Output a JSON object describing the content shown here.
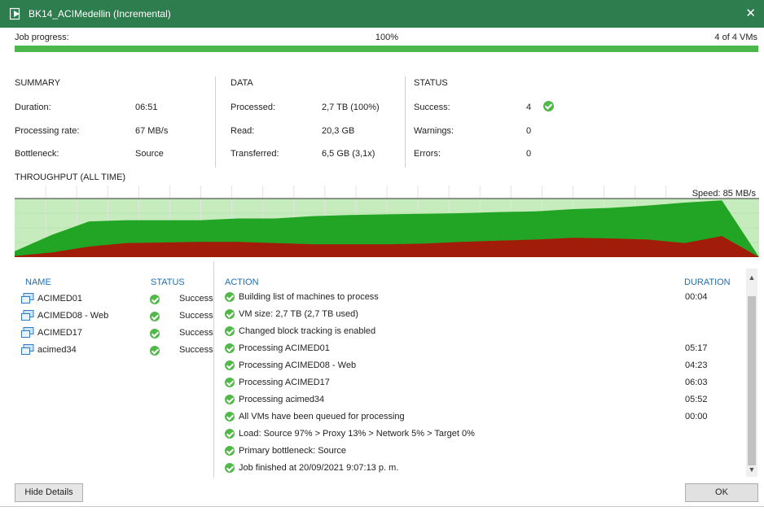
{
  "window": {
    "title": "BK14_ACIMedellin (Incremental)",
    "close": "✕"
  },
  "progress": {
    "label": "Job progress:",
    "percent_text": "100%",
    "vms_text": "4 of 4 VMs",
    "fraction": 1.0
  },
  "summary": {
    "heading": "SUMMARY",
    "rows": [
      {
        "label": "Duration:",
        "value": "06:51"
      },
      {
        "label": "Processing rate:",
        "value": "67 MB/s"
      },
      {
        "label": "Bottleneck:",
        "value": "Source"
      }
    ]
  },
  "data": {
    "heading": "DATA",
    "rows": [
      {
        "label": "Processed:",
        "value": "2,7 TB (100%)"
      },
      {
        "label": "Read:",
        "value": "20,3 GB"
      },
      {
        "label": "Transferred:",
        "value": "6,5 GB (3,1x)"
      }
    ]
  },
  "status": {
    "heading": "STATUS",
    "rows": [
      {
        "label": "Success:",
        "value": "4"
      },
      {
        "label": "Warnings:",
        "value": "0"
      },
      {
        "label": "Errors:",
        "value": "0"
      }
    ]
  },
  "throughput": {
    "title": "THROUGHPUT (ALL TIME)",
    "speed_label": "Speed: 85 MB/s",
    "colors": {
      "read": "#22a524",
      "transfer": "#a11c09",
      "bg": "#c6ecbe"
    },
    "read_series": [
      0.1,
      0.38,
      0.61,
      0.63,
      0.63,
      0.63,
      0.66,
      0.66,
      0.7,
      0.72,
      0.73,
      0.74,
      0.75,
      0.77,
      0.78,
      0.82,
      0.84,
      0.88,
      0.93,
      0.97,
      0.0
    ],
    "transfer_series": [
      0.02,
      0.08,
      0.18,
      0.24,
      0.25,
      0.26,
      0.26,
      0.24,
      0.22,
      0.22,
      0.22,
      0.23,
      0.26,
      0.28,
      0.3,
      0.33,
      0.32,
      0.3,
      0.24,
      0.36,
      0.0
    ]
  },
  "vms": {
    "col_name": "NAME",
    "col_status": "STATUS",
    "items": [
      {
        "name": "ACIMED01",
        "status": "Success"
      },
      {
        "name": "ACIMED08 - Web",
        "status": "Success"
      },
      {
        "name": "ACIMED17",
        "status": "Success"
      },
      {
        "name": "acimed34",
        "status": "Success"
      }
    ]
  },
  "actions": {
    "col_action": "ACTION",
    "col_duration": "DURATION",
    "items": [
      {
        "text": "Building list of machines to process",
        "duration": "00:04"
      },
      {
        "text": "VM size: 2,7 TB (2,7 TB used)",
        "duration": ""
      },
      {
        "text": "Changed block tracking is enabled",
        "duration": ""
      },
      {
        "text": "Processing ACIMED01",
        "duration": "05:17"
      },
      {
        "text": "Processing ACIMED08 - Web",
        "duration": "04:23"
      },
      {
        "text": "Processing ACIMED17",
        "duration": "06:03"
      },
      {
        "text": "Processing acimed34",
        "duration": "05:52"
      },
      {
        "text": "All VMs have been queued for processing",
        "duration": "00:00"
      },
      {
        "text": "Load: Source 97% > Proxy 13% > Network 5% > Target 0%",
        "duration": ""
      },
      {
        "text": "Primary bottleneck: Source",
        "duration": ""
      },
      {
        "text": "Job finished at 20/09/2021 9:07:13 p. m.",
        "duration": ""
      }
    ]
  },
  "buttons": {
    "hide_details": "Hide Details",
    "ok": "OK"
  }
}
